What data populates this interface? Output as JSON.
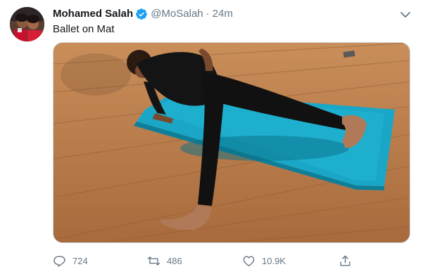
{
  "tweet": {
    "author": {
      "display_name": "Mohamed Salah",
      "handle": "@MoSalah",
      "verified": true,
      "avatar_icon": "profile-photo"
    },
    "separator": "·",
    "time": "24m",
    "text": "Ballet on Mat",
    "media": {
      "kind": "photo",
      "description_icon": "tweet-photo"
    },
    "actions": {
      "reply_count": "724",
      "retweet_count": "486",
      "like_count": "10.9K",
      "share_icon": "share-icon"
    }
  },
  "colors": {
    "accent": "#1da1f2",
    "muted": "#657786",
    "text": "#14171a"
  }
}
